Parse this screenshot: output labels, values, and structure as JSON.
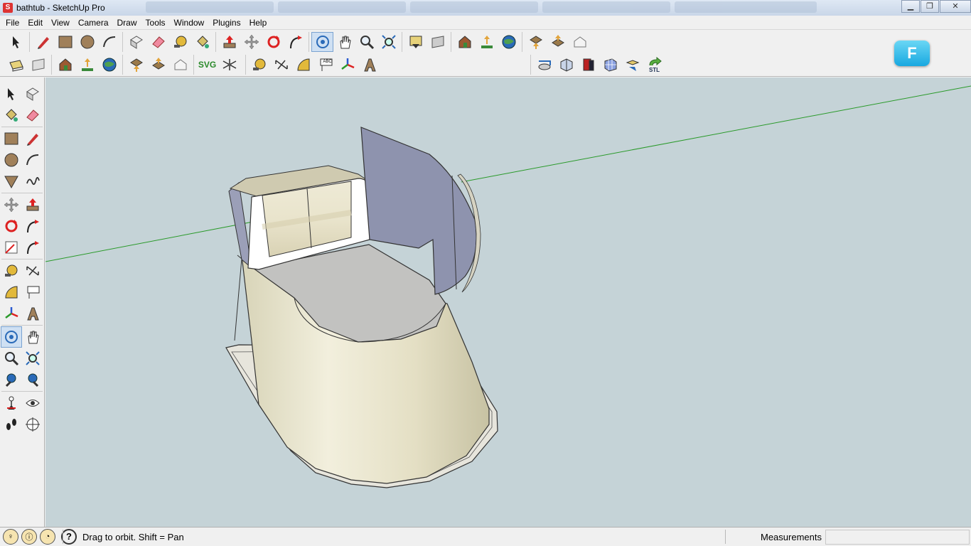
{
  "window": {
    "title": "bathtub - SketchUp Pro",
    "app_icon": "sketchup-icon",
    "minimize": "▁",
    "maximize": "❐",
    "close": "✕"
  },
  "menu": [
    "File",
    "Edit",
    "View",
    "Camera",
    "Draw",
    "Tools",
    "Window",
    "Plugins",
    "Help"
  ],
  "toolbar2": {
    "svg_label": "SVG",
    "stl_label": "STL",
    "abc_label": "ABC"
  },
  "badge": {
    "label": "F"
  },
  "status": {
    "message": "Drag to orbit.  Shift = Pan",
    "help": "?",
    "measurements_label": "Measurements",
    "measurements_value": ""
  },
  "colors": {
    "viewport_bg": "#c5d3d7",
    "model_front_face": "#ece8d2",
    "model_back_face": "#8e93ae",
    "axis_green": "#2a9a2a"
  }
}
